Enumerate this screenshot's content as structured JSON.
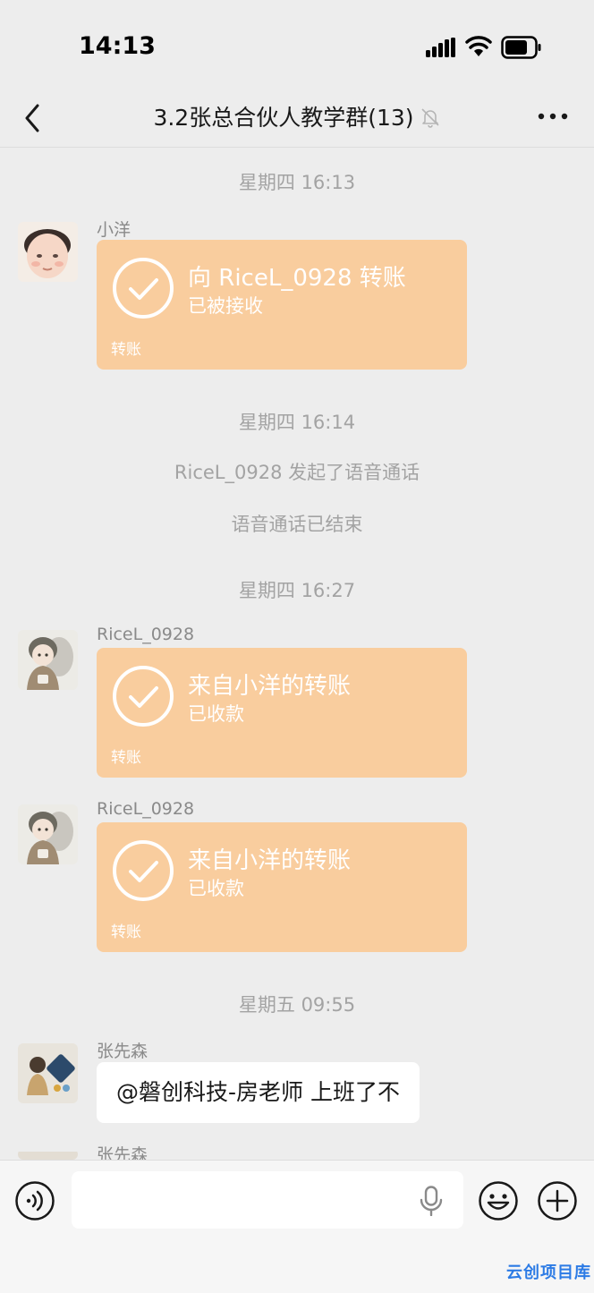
{
  "status_bar": {
    "time": "14:13"
  },
  "nav": {
    "title": "3.2张总合伙人教学群(13)"
  },
  "messages": {
    "sep1": "星期四 16:13",
    "m1": {
      "sender": "小洋",
      "title": "向 RiceL_0928 转账",
      "status": "已被接收",
      "label": "转账"
    },
    "sep2": "星期四 16:14",
    "sys1": "RiceL_0928 发起了语音通话",
    "sys2": "语音通话已结束",
    "sep3": "星期四 16:27",
    "m2": {
      "sender": "RiceL_0928",
      "title": "来自小洋的转账",
      "status": "已收款",
      "label": "转账"
    },
    "m3": {
      "sender": "RiceL_0928",
      "title": "来自小洋的转账",
      "status": "已收款",
      "label": "转账"
    },
    "sep4": "星期五 09:55",
    "m4": {
      "sender": "张先森",
      "text": "@磐创科技-房老师 上班了不"
    },
    "m5": {
      "sender": "张先森"
    }
  },
  "watermark": "云创项目库",
  "colors": {
    "transfer_bg": "#f9cd9e",
    "chat_bg": "#ededed",
    "watermark": "#2c7be5"
  }
}
